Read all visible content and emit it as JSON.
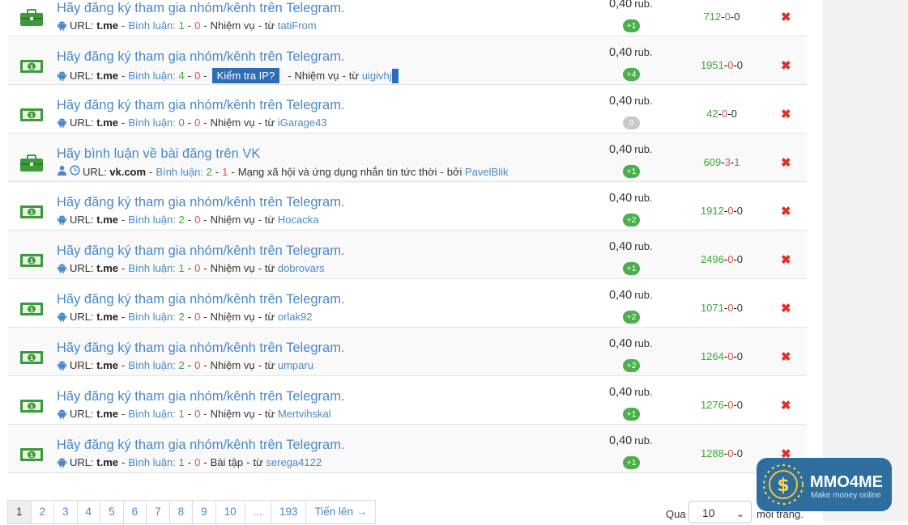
{
  "tasks": [
    {
      "icon": "briefcase-icon",
      "title": "Hãy đăng ký tham gia nhóm/kênh trên Telegram.",
      "url_label": "URL:",
      "domain": "t.me",
      "comments_label": "Bình luận:",
      "comments_pos": "1",
      "comments_neg": "0",
      "category": "Nhiệm vụ",
      "from_label": "từ",
      "author": "tatiFrom",
      "price": "0,40",
      "unit": "rub.",
      "badge": "+1",
      "stat_ok": "712",
      "stat_bad": "0",
      "stat_extra": "0"
    },
    {
      "icon": "money-icon",
      "title": "Hãy đăng ký tham gia nhóm/kênh trên Telegram.",
      "url_label": "URL:",
      "domain": "t.me",
      "comments_label": "Bình luận:",
      "comments_pos": "4",
      "comments_neg": "0",
      "ip_check": "Kiểm tra IP?",
      "category": "Nhiệm vụ",
      "from_label": "từ",
      "author": "uigivhj",
      "price": "0,40",
      "unit": "rub.",
      "badge": "+4",
      "stat_ok": "1951",
      "stat_bad": "0",
      "stat_extra": "0"
    },
    {
      "icon": "money-icon",
      "title": "Hãy đăng ký tham gia nhóm/kênh trên Telegram.",
      "url_label": "URL:",
      "domain": "t.me",
      "comments_label": "Bình luận:",
      "comments_pos": "0",
      "comments_neg": "0",
      "category": "Nhiệm vụ",
      "from_label": "từ",
      "author": "iGarage43",
      "price": "0,40",
      "unit": "rub.",
      "badge": "0",
      "stat_ok": "42",
      "stat_bad": "0",
      "stat_extra": "0"
    },
    {
      "icon": "briefcase-icon",
      "title": "Hãy bình luận về bài đăng trên VK",
      "url_label": "URL:",
      "domain": "vk.com",
      "comments_label": "Bình luận:",
      "comments_pos": "2",
      "comments_neg": "1",
      "category": "Mạng xã hội và ứng dụng nhắn tin tức thời",
      "from_label": "bởi",
      "author": "PavelBlik",
      "price": "0,40",
      "unit": "rub.",
      "badge": "+1",
      "stat_ok": "609",
      "stat_bad": "3",
      "stat_extra": "1"
    },
    {
      "icon": "money-icon",
      "title": "Hãy đăng ký tham gia nhóm/kênh trên Telegram.",
      "url_label": "URL:",
      "domain": "t.me",
      "comments_label": "Bình luận:",
      "comments_pos": "2",
      "comments_neg": "0",
      "category": "Nhiệm vụ",
      "from_label": "từ",
      "author": "Hocacka",
      "price": "0,40",
      "unit": "rub.",
      "badge": "+2",
      "stat_ok": "1912",
      "stat_bad": "0",
      "stat_extra": "0"
    },
    {
      "icon": "money-icon",
      "title": "Hãy đăng ký tham gia nhóm/kênh trên Telegram.",
      "url_label": "URL:",
      "domain": "t.me",
      "comments_label": "Bình luận:",
      "comments_pos": "1",
      "comments_neg": "0",
      "category": "Nhiệm vụ",
      "from_label": "từ",
      "author": "dobrovars",
      "price": "0,40",
      "unit": "rub.",
      "badge": "+1",
      "stat_ok": "2496",
      "stat_bad": "0",
      "stat_extra": "0"
    },
    {
      "icon": "money-icon",
      "title": "Hãy đăng ký tham gia nhóm/kênh trên Telegram.",
      "url_label": "URL:",
      "domain": "t.me",
      "comments_label": "Bình luận:",
      "comments_pos": "2",
      "comments_neg": "0",
      "category": "Nhiệm vụ",
      "from_label": "từ",
      "author": "orlak92",
      "price": "0,40",
      "unit": "rub.",
      "badge": "+2",
      "stat_ok": "1071",
      "stat_bad": "0",
      "stat_extra": "0"
    },
    {
      "icon": "money-icon",
      "title": "Hãy đăng ký tham gia nhóm/kênh trên Telegram.",
      "url_label": "URL:",
      "domain": "t.me",
      "comments_label": "Bình luận:",
      "comments_pos": "2",
      "comments_neg": "0",
      "category": "Nhiệm vụ",
      "from_label": "từ",
      "author": "umparu",
      "price": "0,40",
      "unit": "rub.",
      "badge": "+2",
      "stat_ok": "1264",
      "stat_bad": "0",
      "stat_extra": "0"
    },
    {
      "icon": "money-icon",
      "title": "Hãy đăng ký tham gia nhóm/kênh trên Telegram.",
      "url_label": "URL:",
      "domain": "t.me",
      "comments_label": "Bình luận:",
      "comments_pos": "1",
      "comments_neg": "0",
      "category": "Nhiệm vụ",
      "from_label": "từ",
      "author": "Mertvihskal",
      "price": "0,40",
      "unit": "rub.",
      "badge": "+1",
      "stat_ok": "1276",
      "stat_bad": "0",
      "stat_extra": "0"
    },
    {
      "icon": "money-icon",
      "title": "Hãy đăng ký tham gia nhóm/kênh trên Telegram.",
      "url_label": "URL:",
      "domain": "t.me",
      "comments_label": "Bình luận:",
      "comments_pos": "1",
      "comments_neg": "0",
      "category": "Bài tập",
      "from_label": "từ",
      "author": "serega4122",
      "price": "0,40",
      "unit": "rub.",
      "badge": "+1",
      "stat_ok": "1288",
      "stat_bad": "0",
      "stat_extra": "0"
    }
  ],
  "pagination": {
    "pages": [
      "1",
      "2",
      "3",
      "4",
      "5",
      "6",
      "7",
      "8",
      "9",
      "10",
      "...",
      "193"
    ],
    "active": "1",
    "next_label": "Tiến lên →"
  },
  "per_page": {
    "before": "Qua",
    "value": "10",
    "after": "mỗi trang."
  },
  "watermark": {
    "brand": "MMO4ME",
    "tagline": "Make money online"
  },
  "colors": {
    "link": "#4a88c8",
    "positive": "#3aaa35",
    "negative": "#d9534f",
    "badge": "#4cae4c",
    "delete": "#e0302a",
    "logo_bg": "#2e6e9e"
  }
}
